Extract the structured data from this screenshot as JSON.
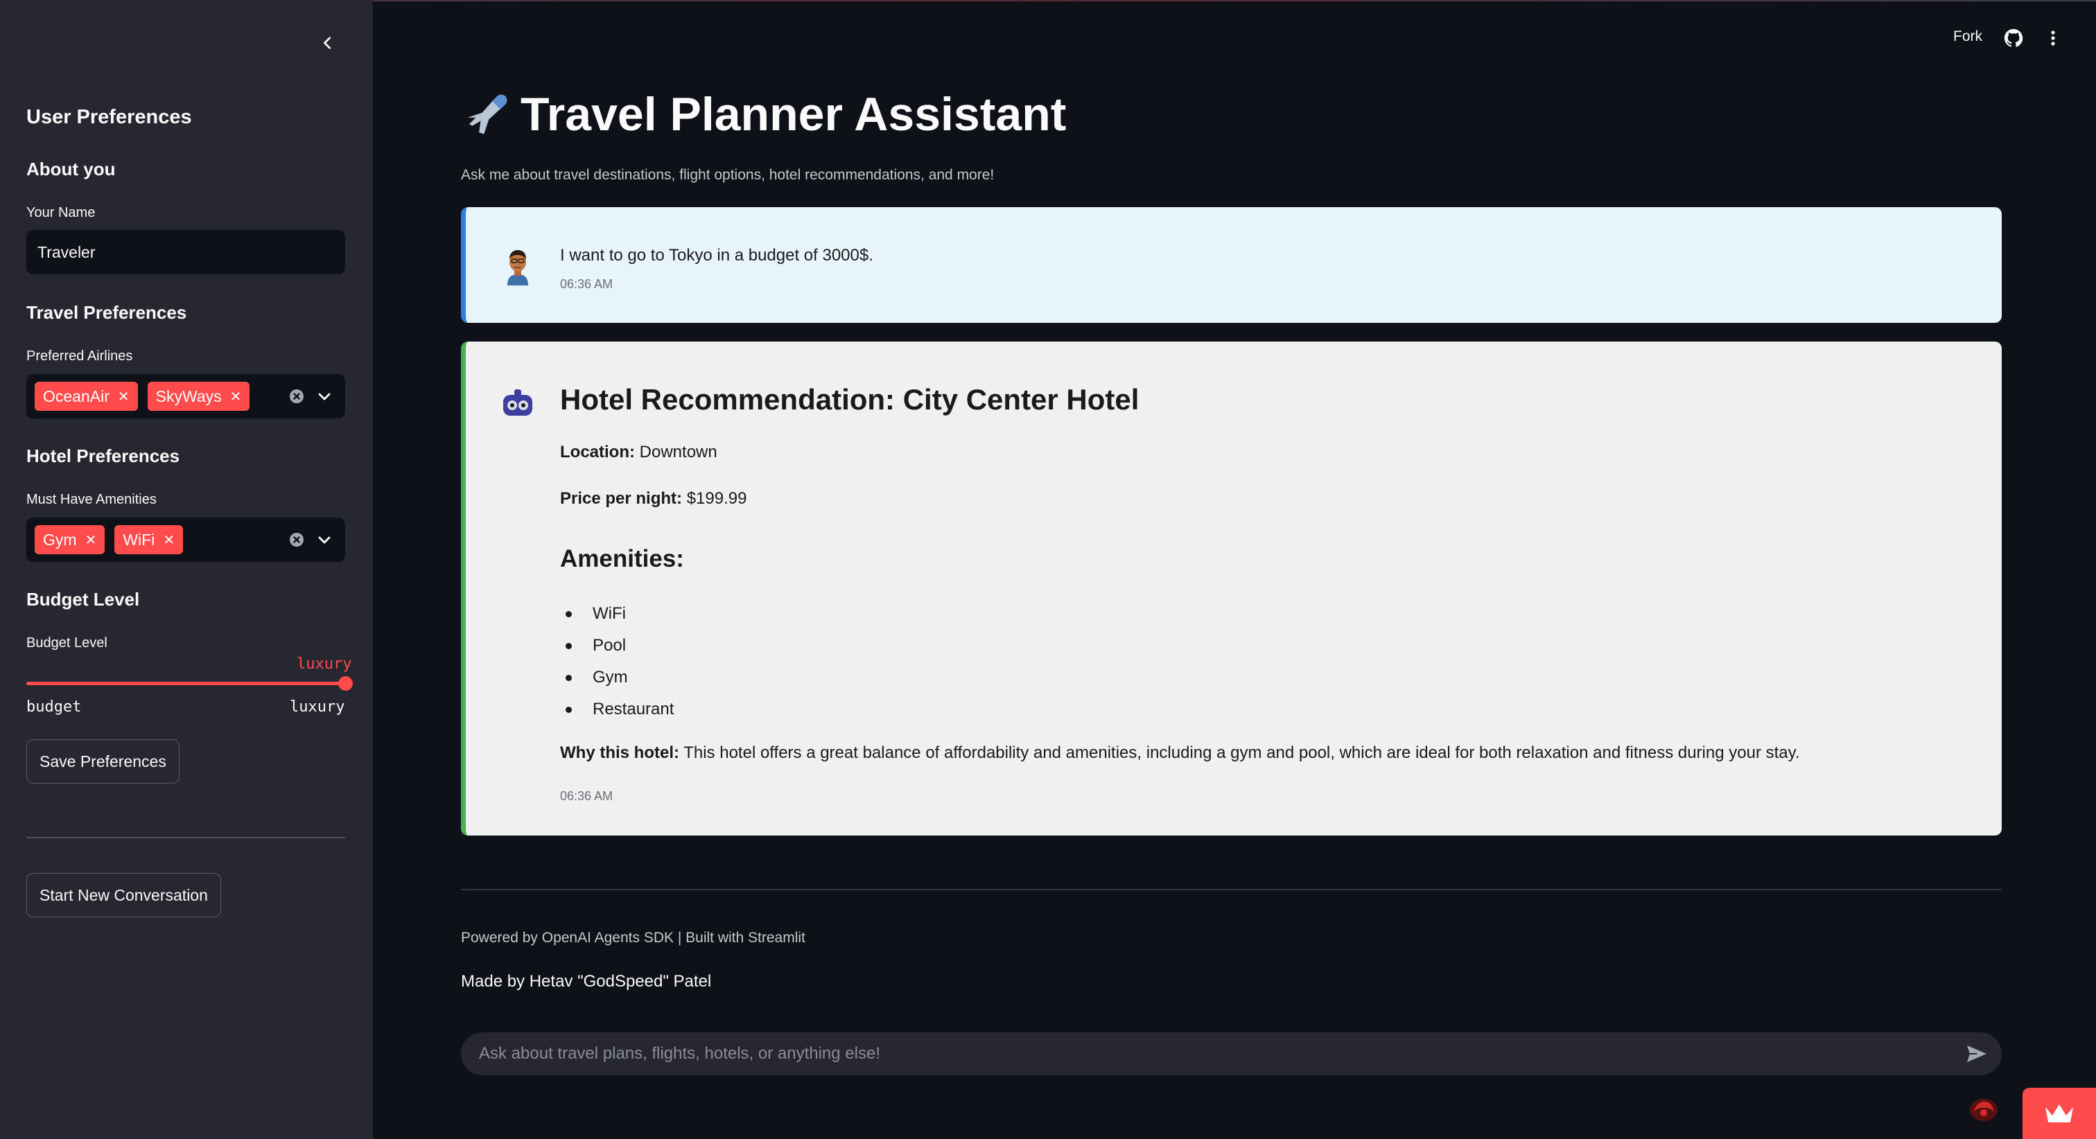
{
  "header": {
    "fork_label": "Fork"
  },
  "sidebar": {
    "heading": "User Preferences",
    "about": {
      "heading": "About you",
      "name_label": "Your Name",
      "name_value": "Traveler"
    },
    "travel": {
      "heading": "Travel Preferences",
      "airlines_label": "Preferred Airlines",
      "airlines": [
        "OceanAir",
        "SkyWays"
      ]
    },
    "hotel": {
      "heading": "Hotel Preferences",
      "amenities_label": "Must Have Amenities",
      "amenities": [
        "Gym",
        "WiFi"
      ]
    },
    "budget": {
      "heading": "Budget Level",
      "label": "Budget Level",
      "current": "luxury",
      "min_label": "budget",
      "max_label": "luxury",
      "position_fraction": 1.0
    },
    "save_button": "Save Preferences",
    "new_conversation_button": "Start New Conversation"
  },
  "main": {
    "title": "Travel Planner Assistant",
    "subtitle": "Ask me about travel destinations, flight options, hotel recommendations, and more!",
    "user_message": {
      "text": "I want to go to Tokyo in a budget of 3000$.",
      "time": "06:36 AM"
    },
    "bot_message": {
      "heading": "Hotel Recommendation: City Center Hotel",
      "location_label": "Location:",
      "location_value": "Downtown",
      "price_label": "Price per night:",
      "price_value": "$199.99",
      "amenities_heading": "Amenities:",
      "amenities": [
        "WiFi",
        "Pool",
        "Gym",
        "Restaurant"
      ],
      "why_label": "Why this hotel:",
      "why_value": "This hotel offers a great balance of affordability and amenities, including a gym and pool, which are ideal for both relaxation and fitness during your stay.",
      "time": "06:36 AM"
    },
    "footer": {
      "powered": "Powered by OpenAI Agents SDK | Built with Streamlit",
      "made_by": "Made by Hetav \"GodSpeed\" Patel"
    },
    "chat_input_placeholder": "Ask about travel plans, flights, hotels, or anything else!"
  },
  "colors": {
    "accent": "#ff4b4b",
    "sidebar_bg": "#262730",
    "main_bg": "#0e1117",
    "user_msg_bg": "#e8f4fc",
    "user_msg_border": "#2e7de0",
    "bot_msg_bg": "#f0f0f0",
    "bot_msg_border": "#4caf50"
  },
  "icons": {
    "collapse": "chevron-left-icon",
    "github": "github-icon",
    "menu": "more-vertical-icon",
    "clear": "clear-circle-icon",
    "dropdown": "chevron-down-icon",
    "send": "send-icon",
    "title": "airplane-icon",
    "user_avatar": "user-avatar-icon",
    "bot_avatar": "robot-avatar-icon",
    "deploy": "crown-icon"
  }
}
